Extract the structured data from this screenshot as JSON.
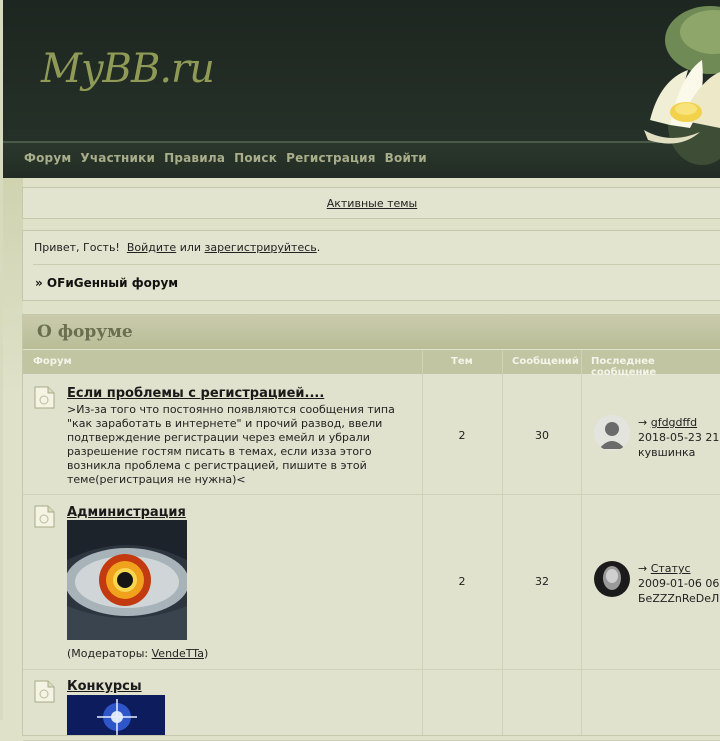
{
  "header": {
    "logo": "MyBB.ru",
    "nav": [
      "Форум",
      "Участники",
      "Правила",
      "Поиск",
      "Регистрация",
      "Войти"
    ]
  },
  "active_topics": "Активные темы",
  "welcome": {
    "greeting": "Привет, Гость!",
    "login": "Войдите",
    "or": "или",
    "register": "зарегистрируйтесь",
    "end": "."
  },
  "breadcrumb": "» OFиGенный форум",
  "category": {
    "title": "О форуме",
    "columns": [
      "Форум",
      "Тем",
      "Сообщений",
      "Последнее сообщение"
    ]
  },
  "forums": [
    {
      "title": "Если проблемы с регистрацией....",
      "description": ">Из-за того что постоянно появляются сообщения типа \"как заработать в интернете\" и прочий развод, ввели подтверждение регистрации через емейл и убрали разрешение гостям писать в темах, если изза этого возникла проблема с регистрацией, пишите в этой теме(регистрация не нужна)<",
      "topics": "2",
      "posts": "30",
      "last_arrow": "→",
      "last_topic": "gfdgdffd",
      "last_date": "2018-05-23 21",
      "last_user": "кувшинка"
    },
    {
      "title": "Администрация",
      "moderators_label": "(Модераторы: ",
      "moderator": "VendeTTa",
      "moderators_end": ")",
      "topics": "2",
      "posts": "32",
      "last_arrow": "→",
      "last_topic": "Статус",
      "last_date": "2009-01-06 06",
      "last_user": "БeZZZnReDeЛ"
    },
    {
      "title": "Конкурсы"
    }
  ]
}
